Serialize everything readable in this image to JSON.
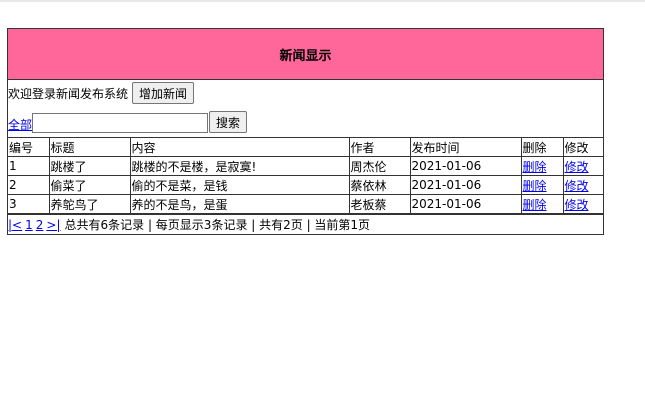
{
  "header": {
    "title": "新闻显示"
  },
  "welcome": {
    "text": "欢迎登录新闻发布系统",
    "add_button": "增加新闻"
  },
  "search": {
    "all_link": "全部",
    "input_value": "",
    "placeholder": "",
    "button": "搜索"
  },
  "table": {
    "columns": [
      "编号",
      "标题",
      "内容",
      "作者",
      "发布时间",
      "删除",
      "修改"
    ],
    "rows": [
      {
        "id": "1",
        "title": "跳楼了",
        "content": "跳楼的不是楼，是寂寞!",
        "author": "周杰伦",
        "date": "2021-01-06",
        "delete": "删除",
        "edit": "修改"
      },
      {
        "id": "2",
        "title": "偷菜了",
        "content": "偷的不是菜，是钱",
        "author": "蔡依林",
        "date": "2021-01-06",
        "delete": "删除",
        "edit": "修改"
      },
      {
        "id": "3",
        "title": "养鸵鸟了",
        "content": "养的不是鸟，是蛋",
        "author": "老板蔡",
        "date": "2021-01-06",
        "delete": "删除",
        "edit": "修改"
      }
    ]
  },
  "pager": {
    "first": "|<",
    "page1": "1",
    "page2": "2",
    "last": ">|",
    "summary": "总共有6条记录 | 每页显示3条记录 | 共有2页 | 当前第1页"
  }
}
